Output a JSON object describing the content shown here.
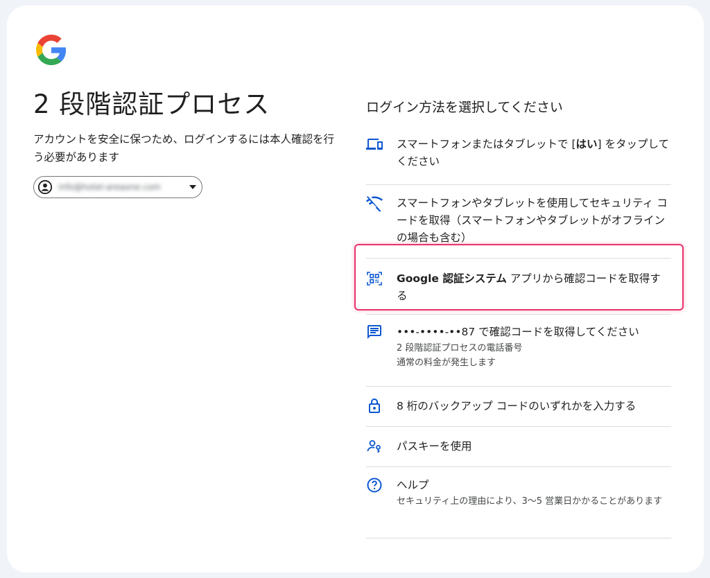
{
  "page": {
    "title": "2 段階認証プロセス",
    "subtitle": "アカウントを安全に保つため、ログインするには本人確認を行う必要があります"
  },
  "account": {
    "email": "info@hotel-areaone.com"
  },
  "options_heading": "ログイン方法を選択してください",
  "options": [
    {
      "icon": "devices-icon",
      "pre": "スマートフォンまたはタブレットで [",
      "bold": "はい",
      "post": "] をタップしてください"
    },
    {
      "icon": "offline-phone-icon",
      "text": "スマートフォンやタブレットを使用してセキュリティ コードを取得（スマートフォンやタブレットがオフラインの場合も含む）"
    },
    {
      "icon": "qr-scan-icon",
      "bold": "Google 認証システム",
      "post": " アプリから確認コードを取得する"
    },
    {
      "icon": "sms-icon",
      "text": "•••-••••-••87 で確認コードを取得してください",
      "sub1": "2 段階認証プロセスの電話番号",
      "sub2": "通常の料金が発生します"
    },
    {
      "icon": "lock-icon",
      "text": "8 桁のバックアップ コードのいずれかを入力する"
    },
    {
      "icon": "passkey-icon",
      "text": "パスキーを使用"
    },
    {
      "icon": "help-icon",
      "text": "ヘルプ",
      "sub1": "セキュリティ上の理由により、3〜5 営業日かかることがあります"
    }
  ],
  "colors": {
    "icon_blue": "#0b57d0",
    "highlight": "#e8336b",
    "background": "#f0f4f9"
  }
}
